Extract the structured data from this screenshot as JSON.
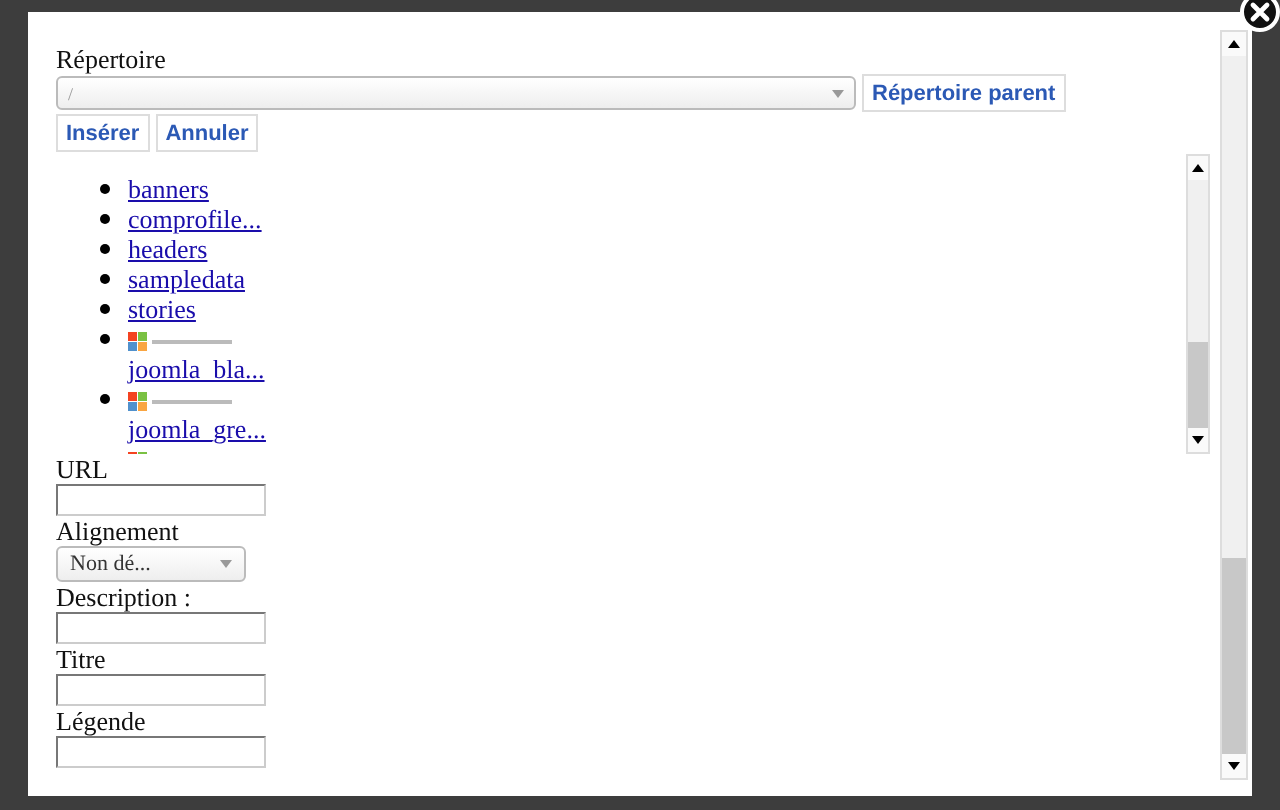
{
  "directory": {
    "label": "Répertoire",
    "value": "/",
    "parent_button": "Répertoire parent"
  },
  "actions": [
    "Insérer",
    "Annuler"
  ],
  "files": [
    {
      "kind": "folder",
      "name": "banners"
    },
    {
      "kind": "folder",
      "name": "comprofile..."
    },
    {
      "kind": "folder",
      "name": "headers"
    },
    {
      "kind": "folder",
      "name": "sampledata"
    },
    {
      "kind": "folder",
      "name": "stories"
    },
    {
      "kind": "image",
      "name": "joomla_bla..."
    },
    {
      "kind": "image",
      "name": "joomla_gre..."
    },
    {
      "kind": "image"
    }
  ],
  "fields": [
    {
      "kind": "text",
      "label": "URL"
    },
    {
      "kind": "select",
      "label": "Alignement",
      "value": "Non dé..."
    },
    {
      "kind": "text",
      "label": "Description :"
    },
    {
      "kind": "text",
      "label": "Titre"
    },
    {
      "kind": "text",
      "label": "Légende"
    }
  ]
}
